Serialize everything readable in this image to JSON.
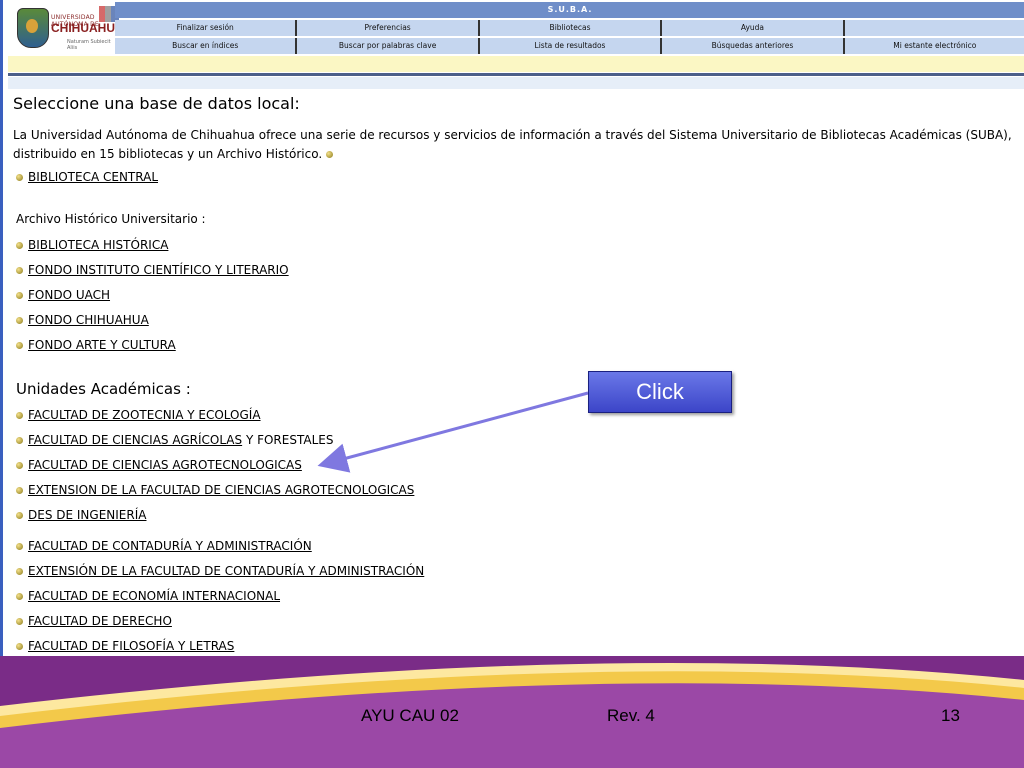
{
  "logo": {
    "small_text": "UNIVERSIDAD AUTÓNOMA DE",
    "main_text": "CHIHUAHUA",
    "sub_text": "Naturam Subiecit Aliis"
  },
  "nav": {
    "title": "S.U.B.A.",
    "row1": [
      "Finalizar sesión",
      "Preferencias",
      "Bibliotecas",
      "Ayuda",
      ""
    ],
    "row2": [
      "Buscar en índices",
      "Buscar por palabras clave",
      "Lista de resultados",
      "Búsquedas anteriores",
      "Mi estante electrónico"
    ]
  },
  "heading": "Seleccione una base de datos local:",
  "intro": "La Universidad Autónoma de Chihuahua ofrece una serie de recursos y servicios de información a través del Sistema Universitario de Bibliotecas Académicas (SUBA), distribuido en 15 bibliotecas y un Archivo Histórico.",
  "central": "BIBLIOTECA CENTRAL",
  "archivo_title": "Archivo Histórico Universitario :",
  "archivo_items": [
    "BIBLIOTECA HISTÓRICA",
    "FONDO INSTITUTO CIENTÍFICO Y LITERARIO ",
    "FONDO UACH",
    "FONDO CHIHUAHUA",
    "FONDO ARTE Y CULTURA"
  ],
  "unidades_title": "Unidades Académicas :",
  "unidades_items": [
    "FACULTAD DE ZOOTECNIA Y ECOLOGÍA",
    "FACULTAD DE CIENCIAS AGRÍCOLAS",
    "FACULTAD DE CIENCIAS AGROTECNOLOGICAS",
    "EXTENSION DE LA FACULTAD DE CIENCIAS AGROTECNOLOGICAS",
    "DES DE INGENIERÍA",
    "FACULTAD DE CONTADURÍA Y ADMINISTRACIÓN",
    "EXTENSIÓN DE LA FACULTAD DE CONTADURÍA Y ADMINISTRACIÓN",
    "FACULTAD DE ECONOMÍA INTERNACIONAL",
    "FACULTAD DE DERECHO",
    "FACULTAD DE FILOSOFÍA Y LETRAS"
  ],
  "agricolas_suffix": " Y FORESTALES",
  "click_label": "Click",
  "footer": {
    "code": "AYU CAU 02",
    "rev": "Rev. 4",
    "page": "13"
  },
  "colors": {
    "nav_title": "#6f8ec9",
    "nav_row": "#c5d6ef",
    "button": "#4a55d8",
    "footer": "#9b48a6",
    "arrow": "#7f78e0"
  }
}
